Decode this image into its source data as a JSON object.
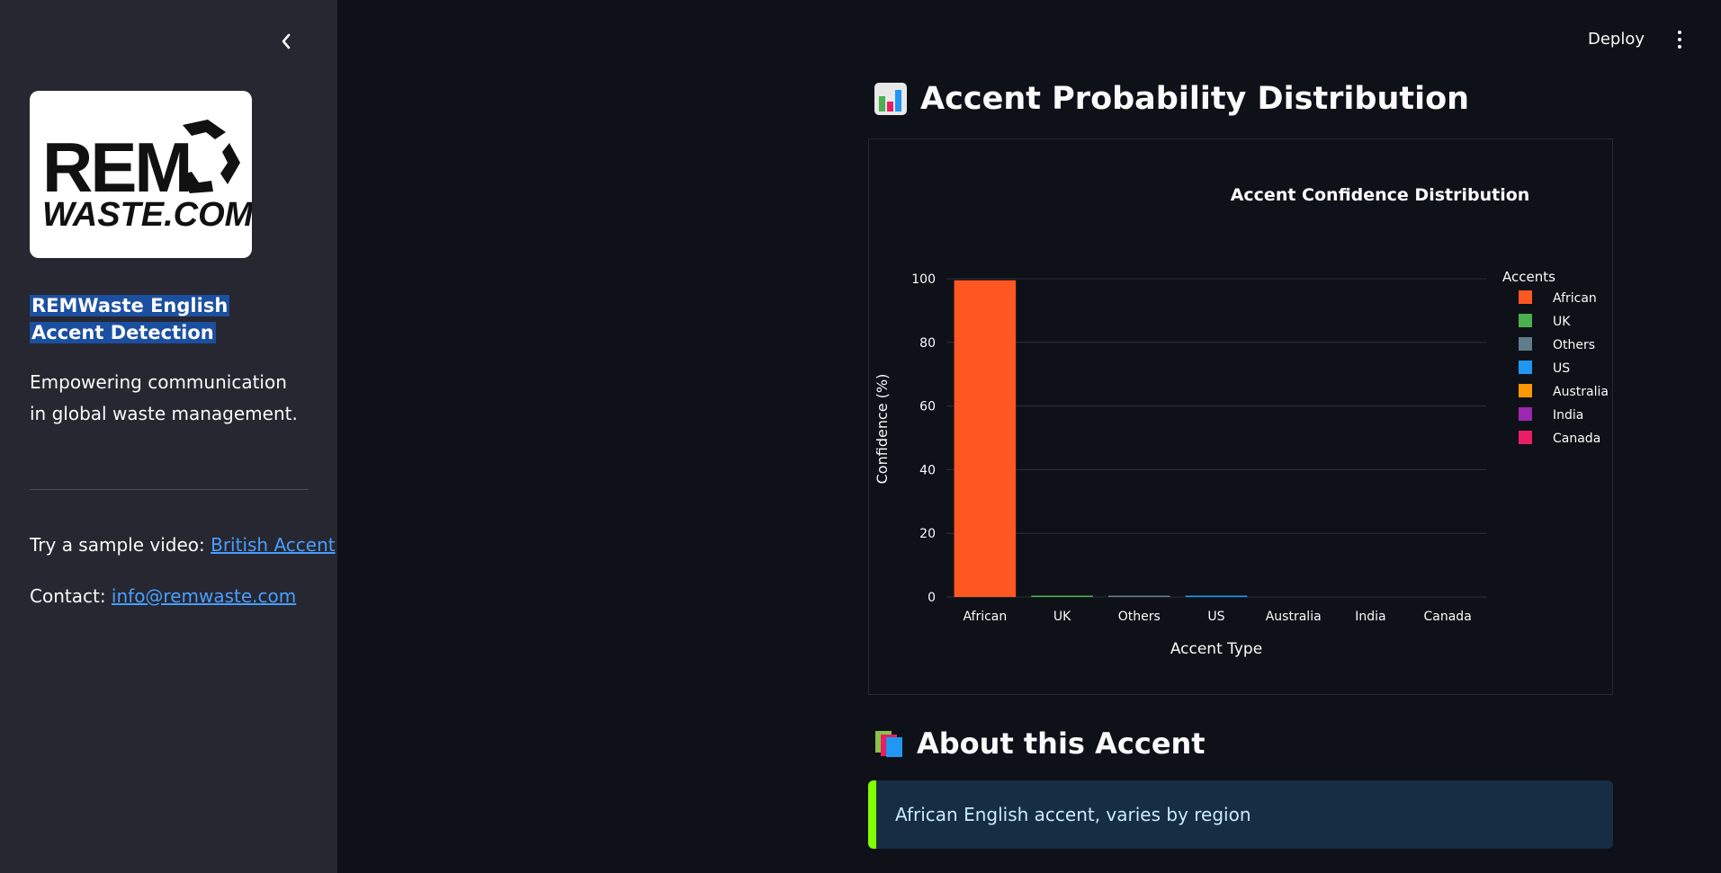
{
  "sidebar": {
    "collapse_icon": "chevron-left-icon",
    "logo": {
      "line1": "REM",
      "line2": "WASTE.COM",
      "icon": "recycle-icon"
    },
    "title": "REMWaste English Accent Detection",
    "description": "Empowering communication in global waste management.",
    "sample_prefix": "Try a sample video: ",
    "sample_link": "British Accent",
    "contact_prefix": "Contact: ",
    "contact_link": "info@remwaste.com"
  },
  "header": {
    "deploy_label": "Deploy",
    "menu_icon": "more-vertical-icon"
  },
  "main": {
    "distribution_heading": "Accent Probability Distribution",
    "distribution_icon": "bar-chart-icon",
    "about_heading": "About this Accent",
    "about_icon": "books-icon",
    "about_text": "African English accent, varies by region"
  },
  "chart_data": {
    "type": "bar",
    "title": "Accent Confidence Distribution",
    "xlabel": "Accent Type",
    "ylabel": "Confidence (%)",
    "ylim": [
      0,
      100
    ],
    "yticks": [
      0,
      20,
      40,
      60,
      80,
      100
    ],
    "grid": true,
    "legend_title": "Accents",
    "legend_position": "right",
    "categories": [
      "African",
      "UK",
      "Others",
      "US",
      "Australia",
      "India",
      "Canada"
    ],
    "values": [
      99.5,
      0.2,
      0.1,
      0.2,
      0,
      0,
      0
    ],
    "colors": [
      "#ff5722",
      "#4caf50",
      "#607d8b",
      "#2196f3",
      "#ff9800",
      "#9c27b0",
      "#e91e63"
    ]
  }
}
